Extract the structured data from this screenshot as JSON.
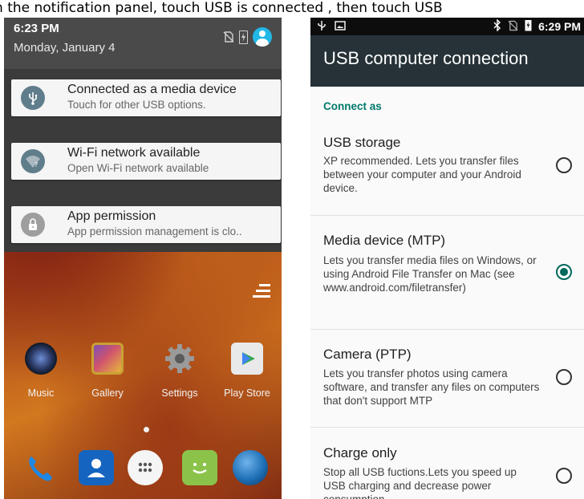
{
  "caption": "In the notification panel, touch USB is connected , then touch USB",
  "left_phone": {
    "time": "6:23 PM",
    "date": "Monday, January 4",
    "notifications": [
      {
        "icon": "usb-icon",
        "title": "Connected as a media device",
        "text": "Touch for other USB options."
      },
      {
        "icon": "wifi-icon",
        "title": "Wi-Fi network available",
        "text": "Open Wi-Fi network available"
      },
      {
        "icon": "lock-icon",
        "title": "App permission",
        "text": "App permission management is clo.."
      }
    ],
    "apps": [
      {
        "label": "Music",
        "icon": "music-icon",
        "color": "#2b3a66"
      },
      {
        "label": "Gallery",
        "icon": "gallery-icon",
        "color": "#c9a132"
      },
      {
        "label": "Settings",
        "icon": "settings-icon",
        "color": "#8a8a8a"
      },
      {
        "label": "Play Store",
        "icon": "play-store-icon",
        "color": "#e9e9e9"
      }
    ],
    "dock": [
      {
        "icon": "phone-icon",
        "color": "#1e88e5"
      },
      {
        "icon": "contacts-icon",
        "color": "#1565c0"
      },
      {
        "icon": "app-drawer-icon",
        "color": "#f5f5f5"
      },
      {
        "icon": "messaging-icon",
        "color": "#8bc34a"
      },
      {
        "icon": "browser-icon",
        "color": "#1e6fb5"
      }
    ]
  },
  "right_phone": {
    "status_time": "6:29 PM",
    "title": "USB computer connection",
    "section": "Connect as",
    "options": [
      {
        "title": "USB storage",
        "desc": "XP recommended. Lets you transfer files between your computer and your Android device.",
        "selected": false
      },
      {
        "title": "Media device (MTP)",
        "desc": "Lets you transfer media files on Windows, or using Android File Transfer on Mac (see www.android.com/filetransfer)",
        "selected": true
      },
      {
        "title": "Camera (PTP)",
        "desc": "Lets you transfer photos using camera software, and transfer any files on computers that don't support MTP",
        "selected": false
      },
      {
        "title": "Charge only",
        "desc": "Stop all USB fuctions.Lets you speed up USB charging and decrease power consumption",
        "selected": false
      }
    ]
  },
  "colors": {
    "appbar": "#263238",
    "accent": "#00796b",
    "shade": "#3b3b3b"
  }
}
